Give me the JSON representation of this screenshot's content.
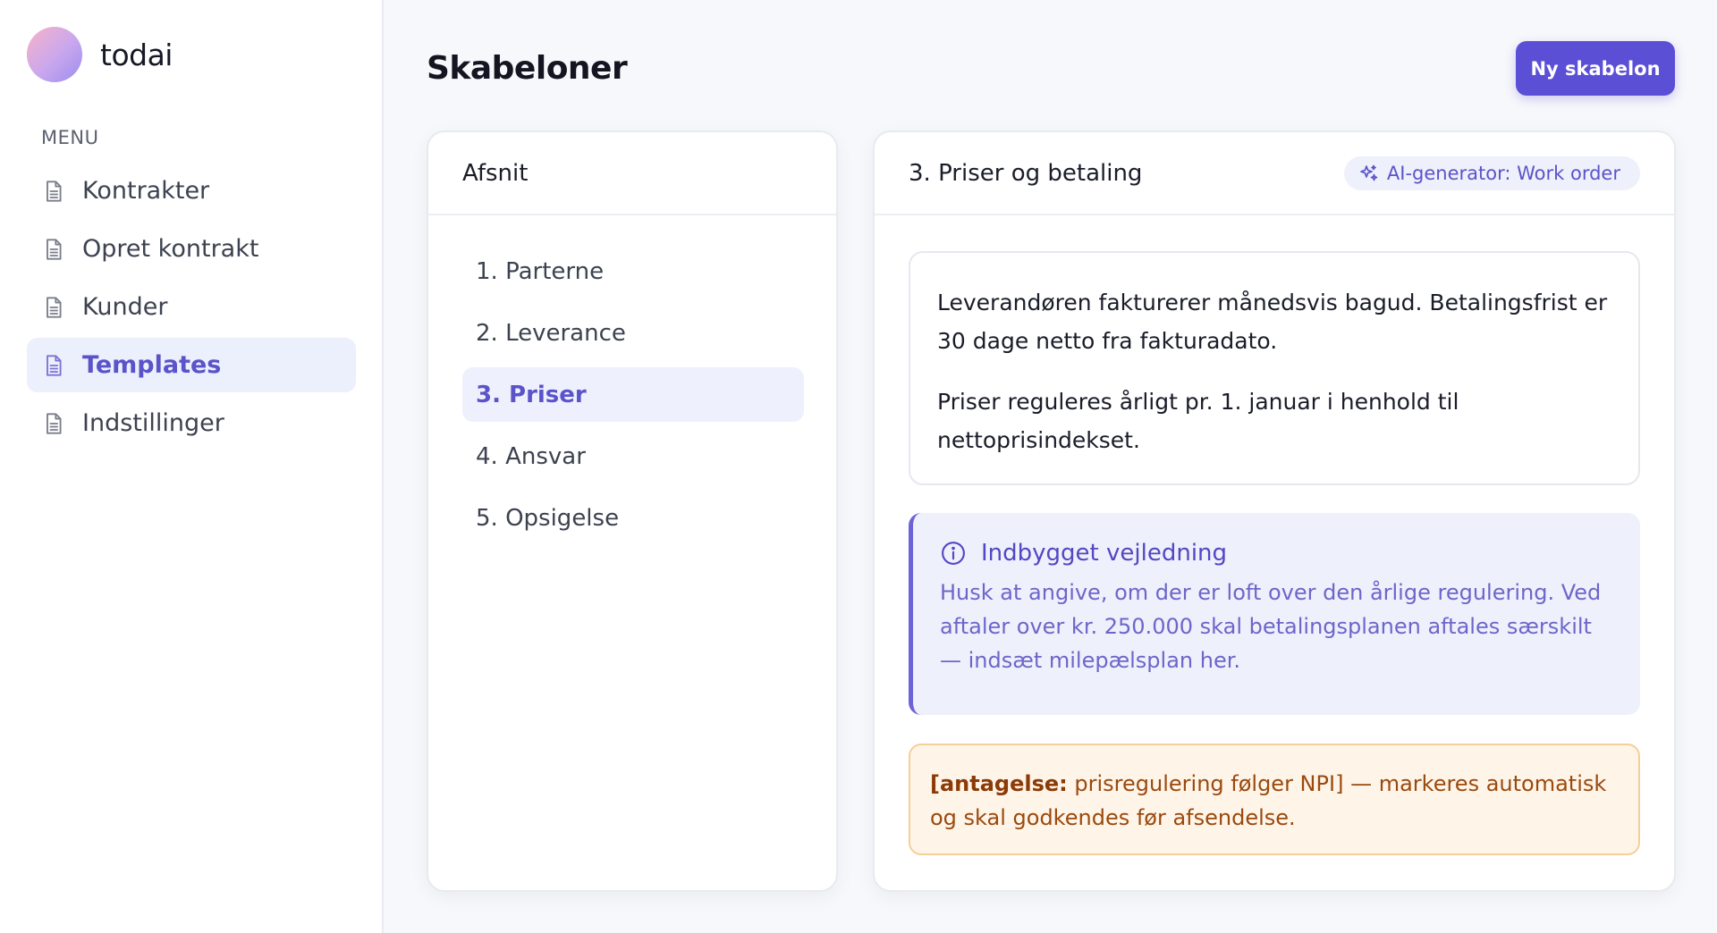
{
  "app": {
    "name": "todai"
  },
  "sidebar": {
    "menu_label": "MENU",
    "items": [
      {
        "label": "Kontrakter",
        "icon": "document-icon"
      },
      {
        "label": "Opret kontrakt",
        "icon": "document-icon"
      },
      {
        "label": "Kunder",
        "icon": "document-icon"
      },
      {
        "label": "Templates",
        "icon": "document-icon",
        "active": true
      },
      {
        "label": "Indstillinger",
        "icon": "document-icon"
      }
    ]
  },
  "header": {
    "title": "Skabeloner",
    "new_button": "Ny skabelon"
  },
  "sections": {
    "title": "Afsnit",
    "items": [
      {
        "label": "1. Parterne"
      },
      {
        "label": "2. Leverance"
      },
      {
        "label": "3. Priser",
        "active": true
      },
      {
        "label": "4. Ansvar"
      },
      {
        "label": "5. Opsigelse"
      }
    ]
  },
  "editor": {
    "title": "3. Priser og betaling",
    "ai_badge": "AI-generator: Work order",
    "paragraphs": [
      "Leverandøren fakturerer månedsvis bagud. Betalingsfrist er 30 dage netto fra fakturadato.",
      "Priser reguleres årligt pr. 1. januar i henhold til nettoprisindekset."
    ],
    "guidance": {
      "title": "Indbygget vejledning",
      "text": "Husk at angive, om der er loft over den årlige regulering. Ved aftaler over kr. 250.000 skal betalingsplanen aftales særskilt — indsæt milepælsplan her."
    },
    "assumption": {
      "tag": "[antagelse:",
      "tag_text": " prisregulering følger NPI]",
      "text": " — markeres automatisk og skal godkendes før afsendelse."
    }
  },
  "colors": {
    "accent": "#5b4fd6",
    "active_bg": "#eceffc",
    "guidance_bg": "#eef0fc",
    "assumption_bg": "#fff4e8",
    "assumption_border": "#f5cf98"
  }
}
